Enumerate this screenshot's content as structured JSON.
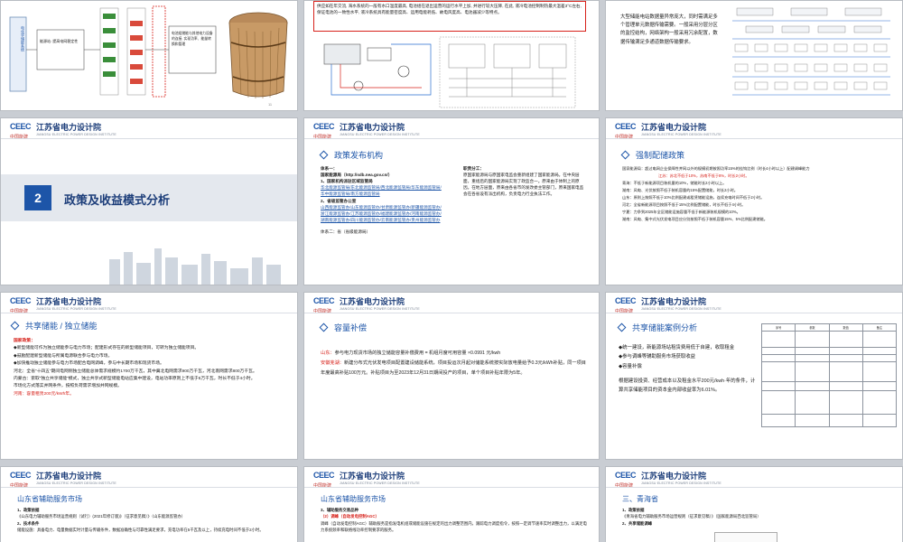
{
  "company": {
    "name": "江苏省电力设计院",
    "name_en": "JIANGSU ELECTRIC POWER DESIGN INSTITUTE",
    "logo_text": "CEEC",
    "logo_sub": "中国能建"
  },
  "s1": {
    "side_label": "电化学储能系统",
    "box_label": "能源站: 提高电网稳定性",
    "right_label": "电池组储能与其他电力设备的连接, 实现功率、能量转换和管理",
    "page_no": "11"
  },
  "s3": {
    "para": "供应如在年交流, 海水系统的一般有水口温度最高, 电池组在退出运营的运行水平上加, 并进行较大压降, 在此, 液冷电池控制制热最大温差3°C左右, 保证电池的一致性水平, 液冷系统具有能量密度高、运用电能耗低、故电风度高、电池器减少等特点。"
  },
  "s4": {
    "para": "大型储能电站数据量异常庞大，同时需满足多个管理单元数据传输需要。一般采用分层分区的监控结构，网络架构一般采用冗余配置，数据传输满足多通道数据传输要求。"
  },
  "s5": {
    "number": "2",
    "title": "政策及收益模式分析"
  },
  "s6": {
    "heading": "政策发布机构",
    "col1_title": "体系一：",
    "col1_sub1": "国家能源局（http://sdb.nea.gov.cn/）",
    "col1_item1": "1、国家机构派驻区域监管局",
    "col1_links1": "华北能源监管局/东北能源监管局/西北能源监管局/华东能源监管局/华中能源监管局/南方能源监管局",
    "col1_item2": "2、省级监管办公室",
    "col1_links2": "山西能源监管办/山东能源监管办/甘肃能源监管办/新疆能源监管办/浙江能源监管办/江苏能源监管办/福建能源监管办/河南能源监管办/湖南能源监管办/四川能源监管办/云南能源监管办/贵州能源监管办",
    "col1_tail": "体系二：省（省级能源局）",
    "col2_title": "职责分工：",
    "col2_body": "原国家能源局与原国家电监会重新组建了国家能源局。在中央层面，重组后的国家能源局实现了政监合一。原来由于体制上的原因。在地方层面，原来由各省市的发改委主管部门，原来国家电监会在各省设有派出机构，负责电力行业执法工作。"
  },
  "s7": {
    "heading": "强制配储政策",
    "line1": "国家能源局：超过电网企业保障性并网以外的规模初期按照功率15%的挂钩比例（时长4小时以上）配建调峰能力",
    "line2": "江苏：苏北不低于10%，苏南不低于8%，时长2小时。",
    "line3": "青海：不低于新能源项目装机量的10%，储能时长2小时以上。",
    "line4": "湖南：风电、光伏按照不低于装机容量的15%配置储能，时长2小时。",
    "line5": "山东：原则上按照不低于10%比例配建或租赁储能设施，连续充电时间不低于2小时。",
    "line6": "河北：全省新能源项目按照不低于15%比例配置储能，时长不低于4小时。",
    "line7": "宁夏：力争到2025年全区储能设施容量不低于新能源装机规模的10%。",
    "line8": "湖南：风电、集中式光伏发电项目应分别按照不低于装机容量15%、5%比例配建储能。"
  },
  "s8": {
    "heading": "共享储能 / 独立储能",
    "lead": "国家政策：",
    "b1": "新型储能可作为独立储能参与电力市场；配建形式存在的新型储能项目，可转为独立储能项目。",
    "b2": "鼓励配建新型储能与所属电源联合参与电力市场。",
    "b3": "加快推动独立储能参与电力市场配合电网调峰，参与中长期市场和现货市场。",
    "b4": "河北：全省“十四五”期间电网侧独立储能总体需求规模约1700万千瓦，其中冀北电网需求900万千瓦，河北南网需求800万千瓦。",
    "b5": "内蒙古：索取“独立共享储能”模式，独立共享式新型储能电站应集中建设，电站功率原则上不低于5万千瓦，时长不低于4小时。",
    "b6": "市场化方式落实并网条件，按照负荷需求增加并网规模。",
    "b7": "河南：容量租赁200元/kWh年。"
  },
  "s9": {
    "heading": "容量补偿",
    "p1a": "山东：",
    "p1b": "参与电力现货市场的独立储能容量补偿费用 = 机组月度可用容量 ×0.0991 元/kwh",
    "p2a": "安徽芜湖：",
    "p2b": "新建分布式光伏发电项目配置建设储能系统，项目投运次月起对储能系统按实际放电量给予0.3元/kWh补贴，同一项目年度最高补贴100万元。补贴项目为至2023年12月31日期间投产的项目，单个项目补贴年限为5年。"
  },
  "s10": {
    "heading": "共享储能案例分析",
    "b1": "统一建设，新能源场站租赁费用低于自建，收取租金",
    "b2": "参与调峰等辅助服务市场获取收益",
    "b3": "容量补偿",
    "summary": "根据建设投资、经营成本以及租金水平200元/kwh·年的条件，计算共享储能项目的资本金内部收益率为6.01%。",
    "table_headers": [
      "序号",
      "参数",
      "数值",
      "备注"
    ]
  },
  "s11": {
    "heading": "山东省辅助服务市场",
    "t1": "1、政策依据",
    "t1body": "《山东电力辅助服务市场运营规则（试行）(2021年修订版)》（征求意见稿）》（山东能源监管办）",
    "t2": "2、技术条件",
    "t2body": "储能设施：具备电力、电量数据实时计量与传输条件，数据准确性与可靠性满足要求，充电功率在5千瓦及以上，持续充电时间不低于2小时。"
  },
  "s12": {
    "heading": "山东省辅助服务市场",
    "t1": "3、辅助服务交易品种",
    "t2": "（2）调峰（自动发电控制AGC）",
    "body": "调峰（自动发电控制AGC）辅助服务是指发电机组或储能设施在规定的出力调整范围内，跟踪电力调度指令，按照一定调节速率实时调整出力，以满足电力系统频率和联络线功率控制要求的服务。"
  },
  "s13": {
    "heading": "三、青海省",
    "t1": "1、政策依据",
    "t1body": "《青海省电力辅助服务市场运营规则（征求意见稿）》（国家能源局西北监管局）",
    "t2": "2、共享储能调峰"
  }
}
